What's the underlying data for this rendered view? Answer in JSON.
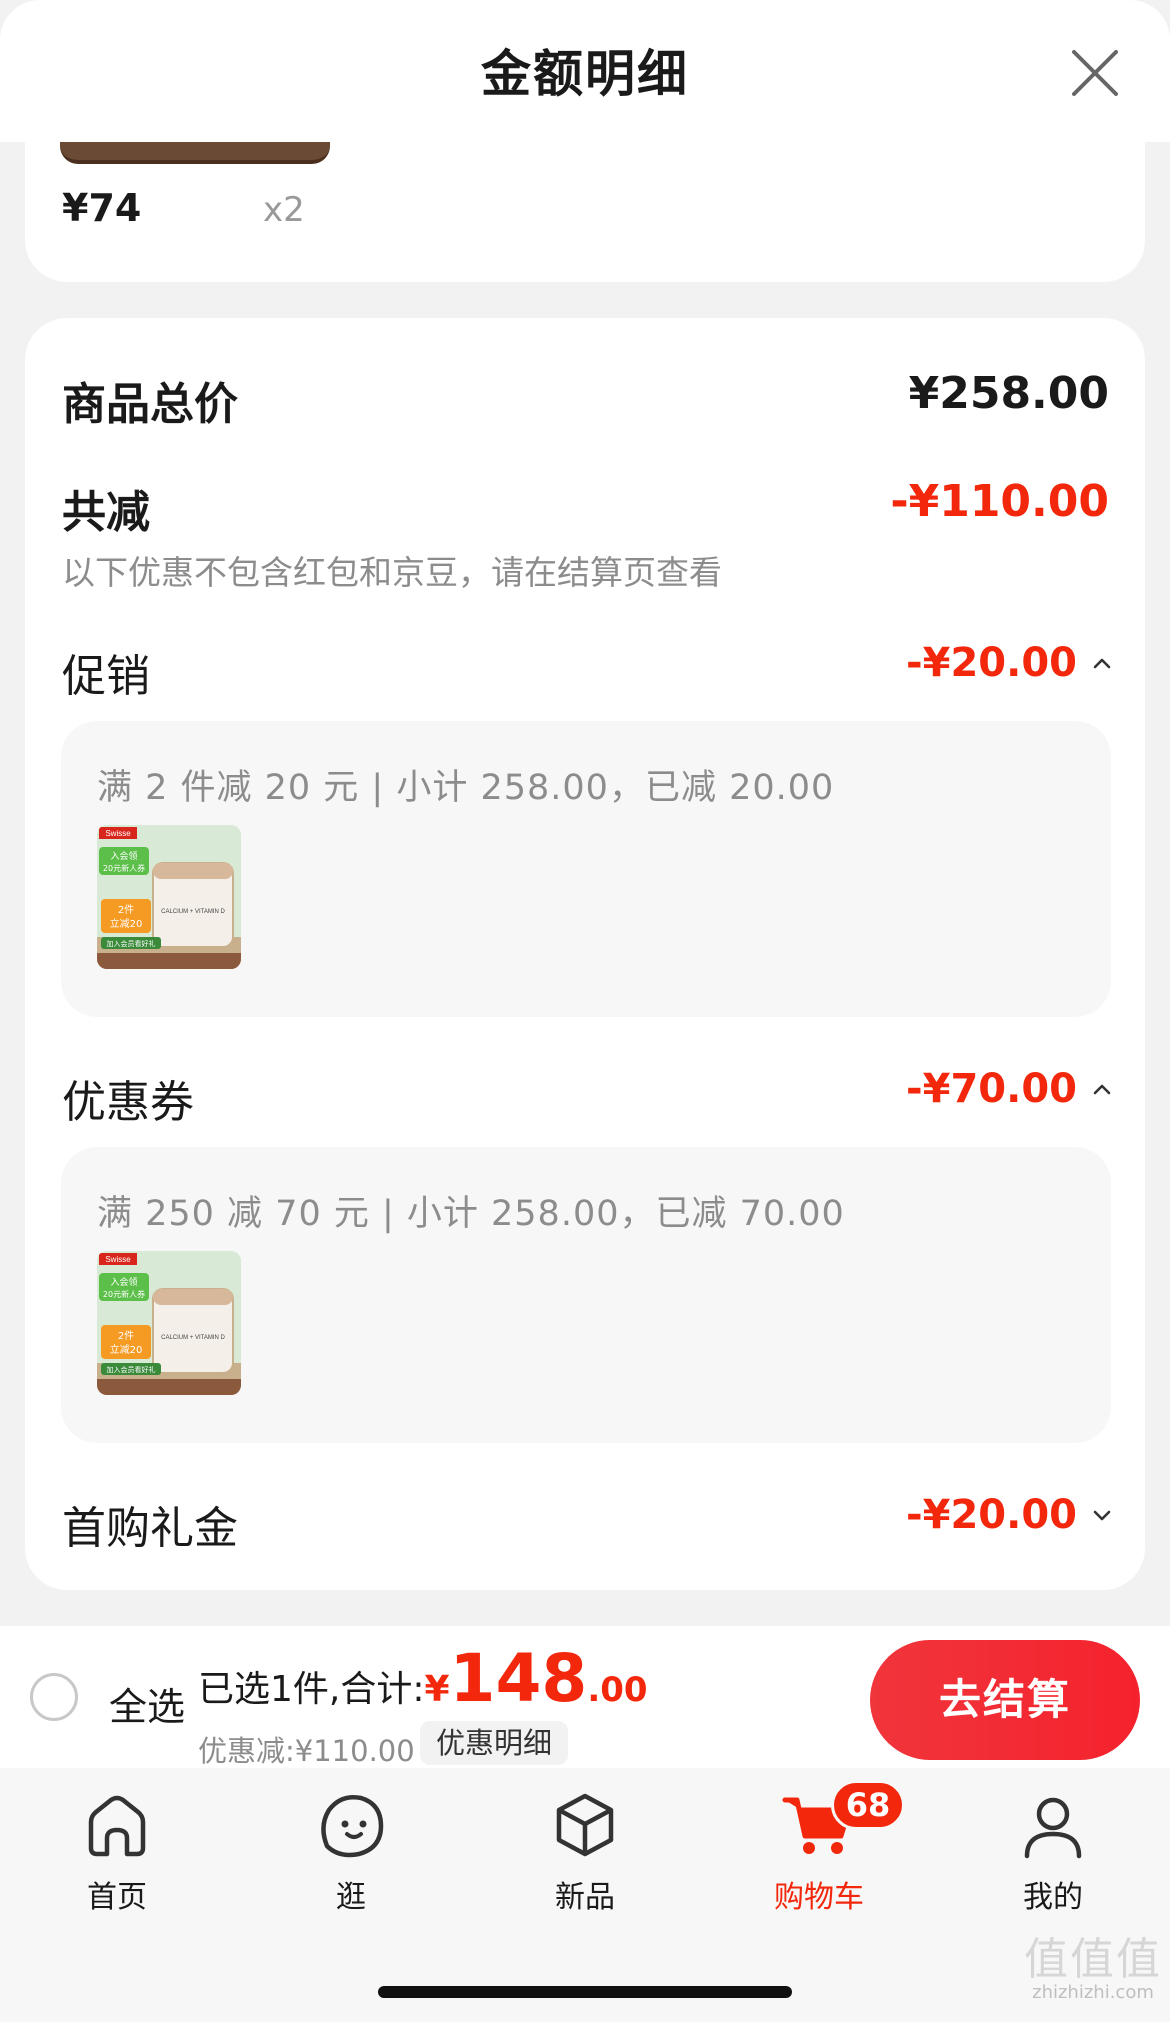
{
  "header": {
    "title": "金额明细"
  },
  "top_item": {
    "price": "¥74",
    "quantity": "x2"
  },
  "summary": {
    "total_label": "商品总价",
    "total_value": "¥258.00",
    "reduce_label": "共减",
    "reduce_value": "-¥110.00",
    "note": "以下优惠不包含红包和京豆，请在结算页查看"
  },
  "sections": [
    {
      "label": "促销",
      "amount": "-¥20.00",
      "expanded": true,
      "detail": "满 2 件减 20 元 | 小计 258.00，已减 20.00"
    },
    {
      "label": "优惠券",
      "amount": "-¥70.00",
      "expanded": true,
      "detail": "满 250 减 70 元 | 小计 258.00，已减 70.00"
    },
    {
      "label": "首购礼金",
      "amount": "-¥20.00",
      "expanded": false
    }
  ],
  "thumbnail": {
    "brand": "Swisse",
    "product": "CALCIUM + VITAMIN D",
    "tag1": "入会领",
    "tag2": "20元新人券",
    "tag3": "2件",
    "tag4": "立减20",
    "tag5": "加入会员看好礼"
  },
  "checkout": {
    "select_all": "全选",
    "selected_prefix": "已选1件,合计:",
    "currency": "¥",
    "total_int": "148",
    "total_dec": ".00",
    "discount": "优惠减:¥110.00",
    "detail_link": "优惠明细",
    "button": "去结算"
  },
  "tabs": [
    {
      "label": "首页",
      "icon": "home-icon",
      "active": false
    },
    {
      "label": "逛",
      "icon": "face-icon",
      "active": false
    },
    {
      "label": "新品",
      "icon": "cube-icon",
      "active": false
    },
    {
      "label": "购物车",
      "icon": "cart-icon",
      "active": true,
      "badge": "68"
    },
    {
      "label": "我的",
      "icon": "user-icon",
      "active": false
    }
  ],
  "watermark": {
    "logo": "值值值",
    "site": "zhizhizhi.com"
  },
  "colors": {
    "accent": "#f2270c",
    "background": "#f2f2f2",
    "card": "#ffffff"
  }
}
